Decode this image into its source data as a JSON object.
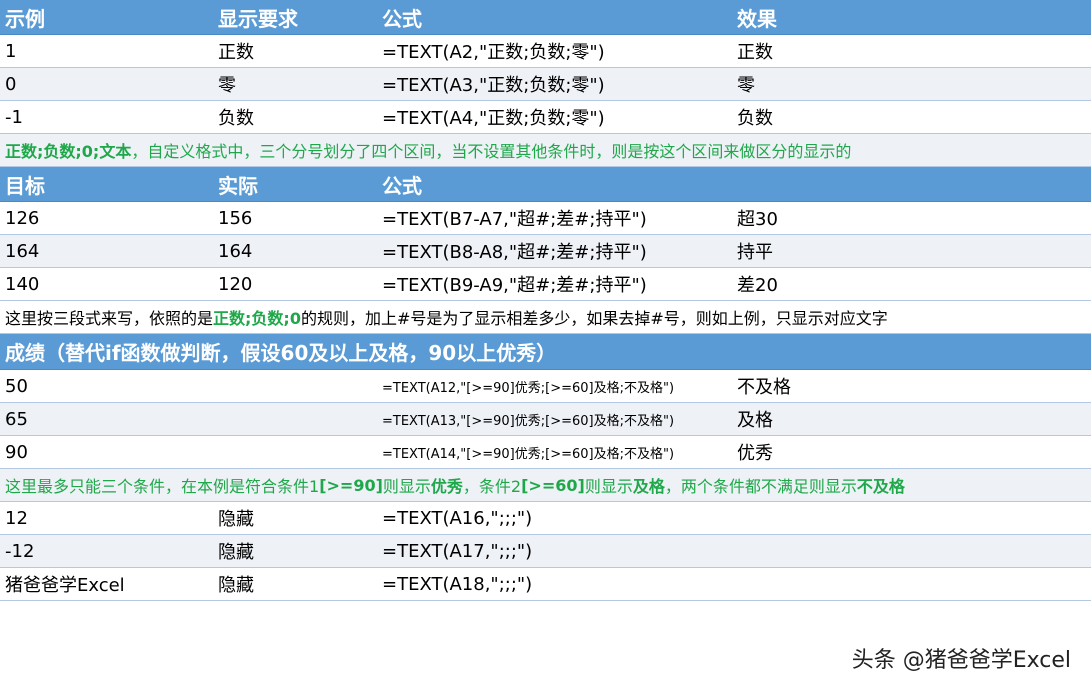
{
  "table1": {
    "headers": [
      "示例",
      "显示要求",
      "公式",
      "效果"
    ],
    "rows": [
      [
        "1",
        "正数",
        "=TEXT(A2,\"正数;负数;零\")",
        "正数"
      ],
      [
        "0",
        "零",
        "=TEXT(A3,\"正数;负数;零\")",
        "零"
      ],
      [
        "-1",
        "负数",
        "=TEXT(A4,\"正数;负数;零\")",
        "负数"
      ]
    ],
    "note_bold": "正数;负数;0;文本",
    "note_rest": "，自定义格式中，三个分号划分了四个区间，当不设置其他条件时，则是按这个区间来做区分的显示的"
  },
  "table2": {
    "headers": [
      "目标",
      "实际",
      "公式",
      ""
    ],
    "rows": [
      [
        "126",
        "156",
        "=TEXT(B7-A7,\"超#;差#;持平\")",
        "超30"
      ],
      [
        "164",
        "164",
        "=TEXT(B8-A8,\"超#;差#;持平\")",
        "持平"
      ],
      [
        "140",
        "120",
        "=TEXT(B9-A9,\"超#;差#;持平\")",
        "差20"
      ]
    ],
    "note_a": "这里按三段式来写，依照的是",
    "note_b": "正数;负数;0",
    "note_c": "的规则，加上#号是为了显示相差多少，如果去掉#号，则如上例，只显示对应文字"
  },
  "table3": {
    "title": "成绩（替代if函数做判断，假设60及以上及格，90以上优秀）",
    "rows": [
      [
        "50",
        "",
        "=TEXT(A12,\"[>=90]优秀;[>=60]及格;不及格\")",
        "不及格"
      ],
      [
        "65",
        "",
        "=TEXT(A13,\"[>=90]优秀;[>=60]及格;不及格\")",
        "及格"
      ],
      [
        "90",
        "",
        "=TEXT(A14,\"[>=90]优秀;[>=60]及格;不及格\")",
        "优秀"
      ]
    ],
    "note_parts": [
      {
        "text": "这里最多只能三个条件，在本例是符合条件1",
        "bold": false
      },
      {
        "text": "[>=90]",
        "bold": true
      },
      {
        "text": "则显示",
        "bold": false
      },
      {
        "text": "优秀",
        "bold": true
      },
      {
        "text": "，条件2",
        "bold": false
      },
      {
        "text": "[>=60]",
        "bold": true
      },
      {
        "text": "则显示",
        "bold": false
      },
      {
        "text": "及格",
        "bold": true
      },
      {
        "text": "，两个条件都不满足则显示",
        "bold": false
      },
      {
        "text": "不及格",
        "bold": true
      }
    ]
  },
  "table4": {
    "rows": [
      [
        "12",
        "隐藏",
        "=TEXT(A16,\";;;\")",
        ""
      ],
      [
        "-12",
        "隐藏",
        "=TEXT(A17,\";;;\")",
        ""
      ],
      [
        "猪爸爸学Excel",
        "隐藏",
        "=TEXT(A18,\";;;\")",
        ""
      ]
    ]
  },
  "watermark": "头条 @猪爸爸学Excel",
  "colors": {
    "header_bg": "#5b9bd5",
    "alt_row": "#eef1f6",
    "green": "#1fa84a"
  }
}
